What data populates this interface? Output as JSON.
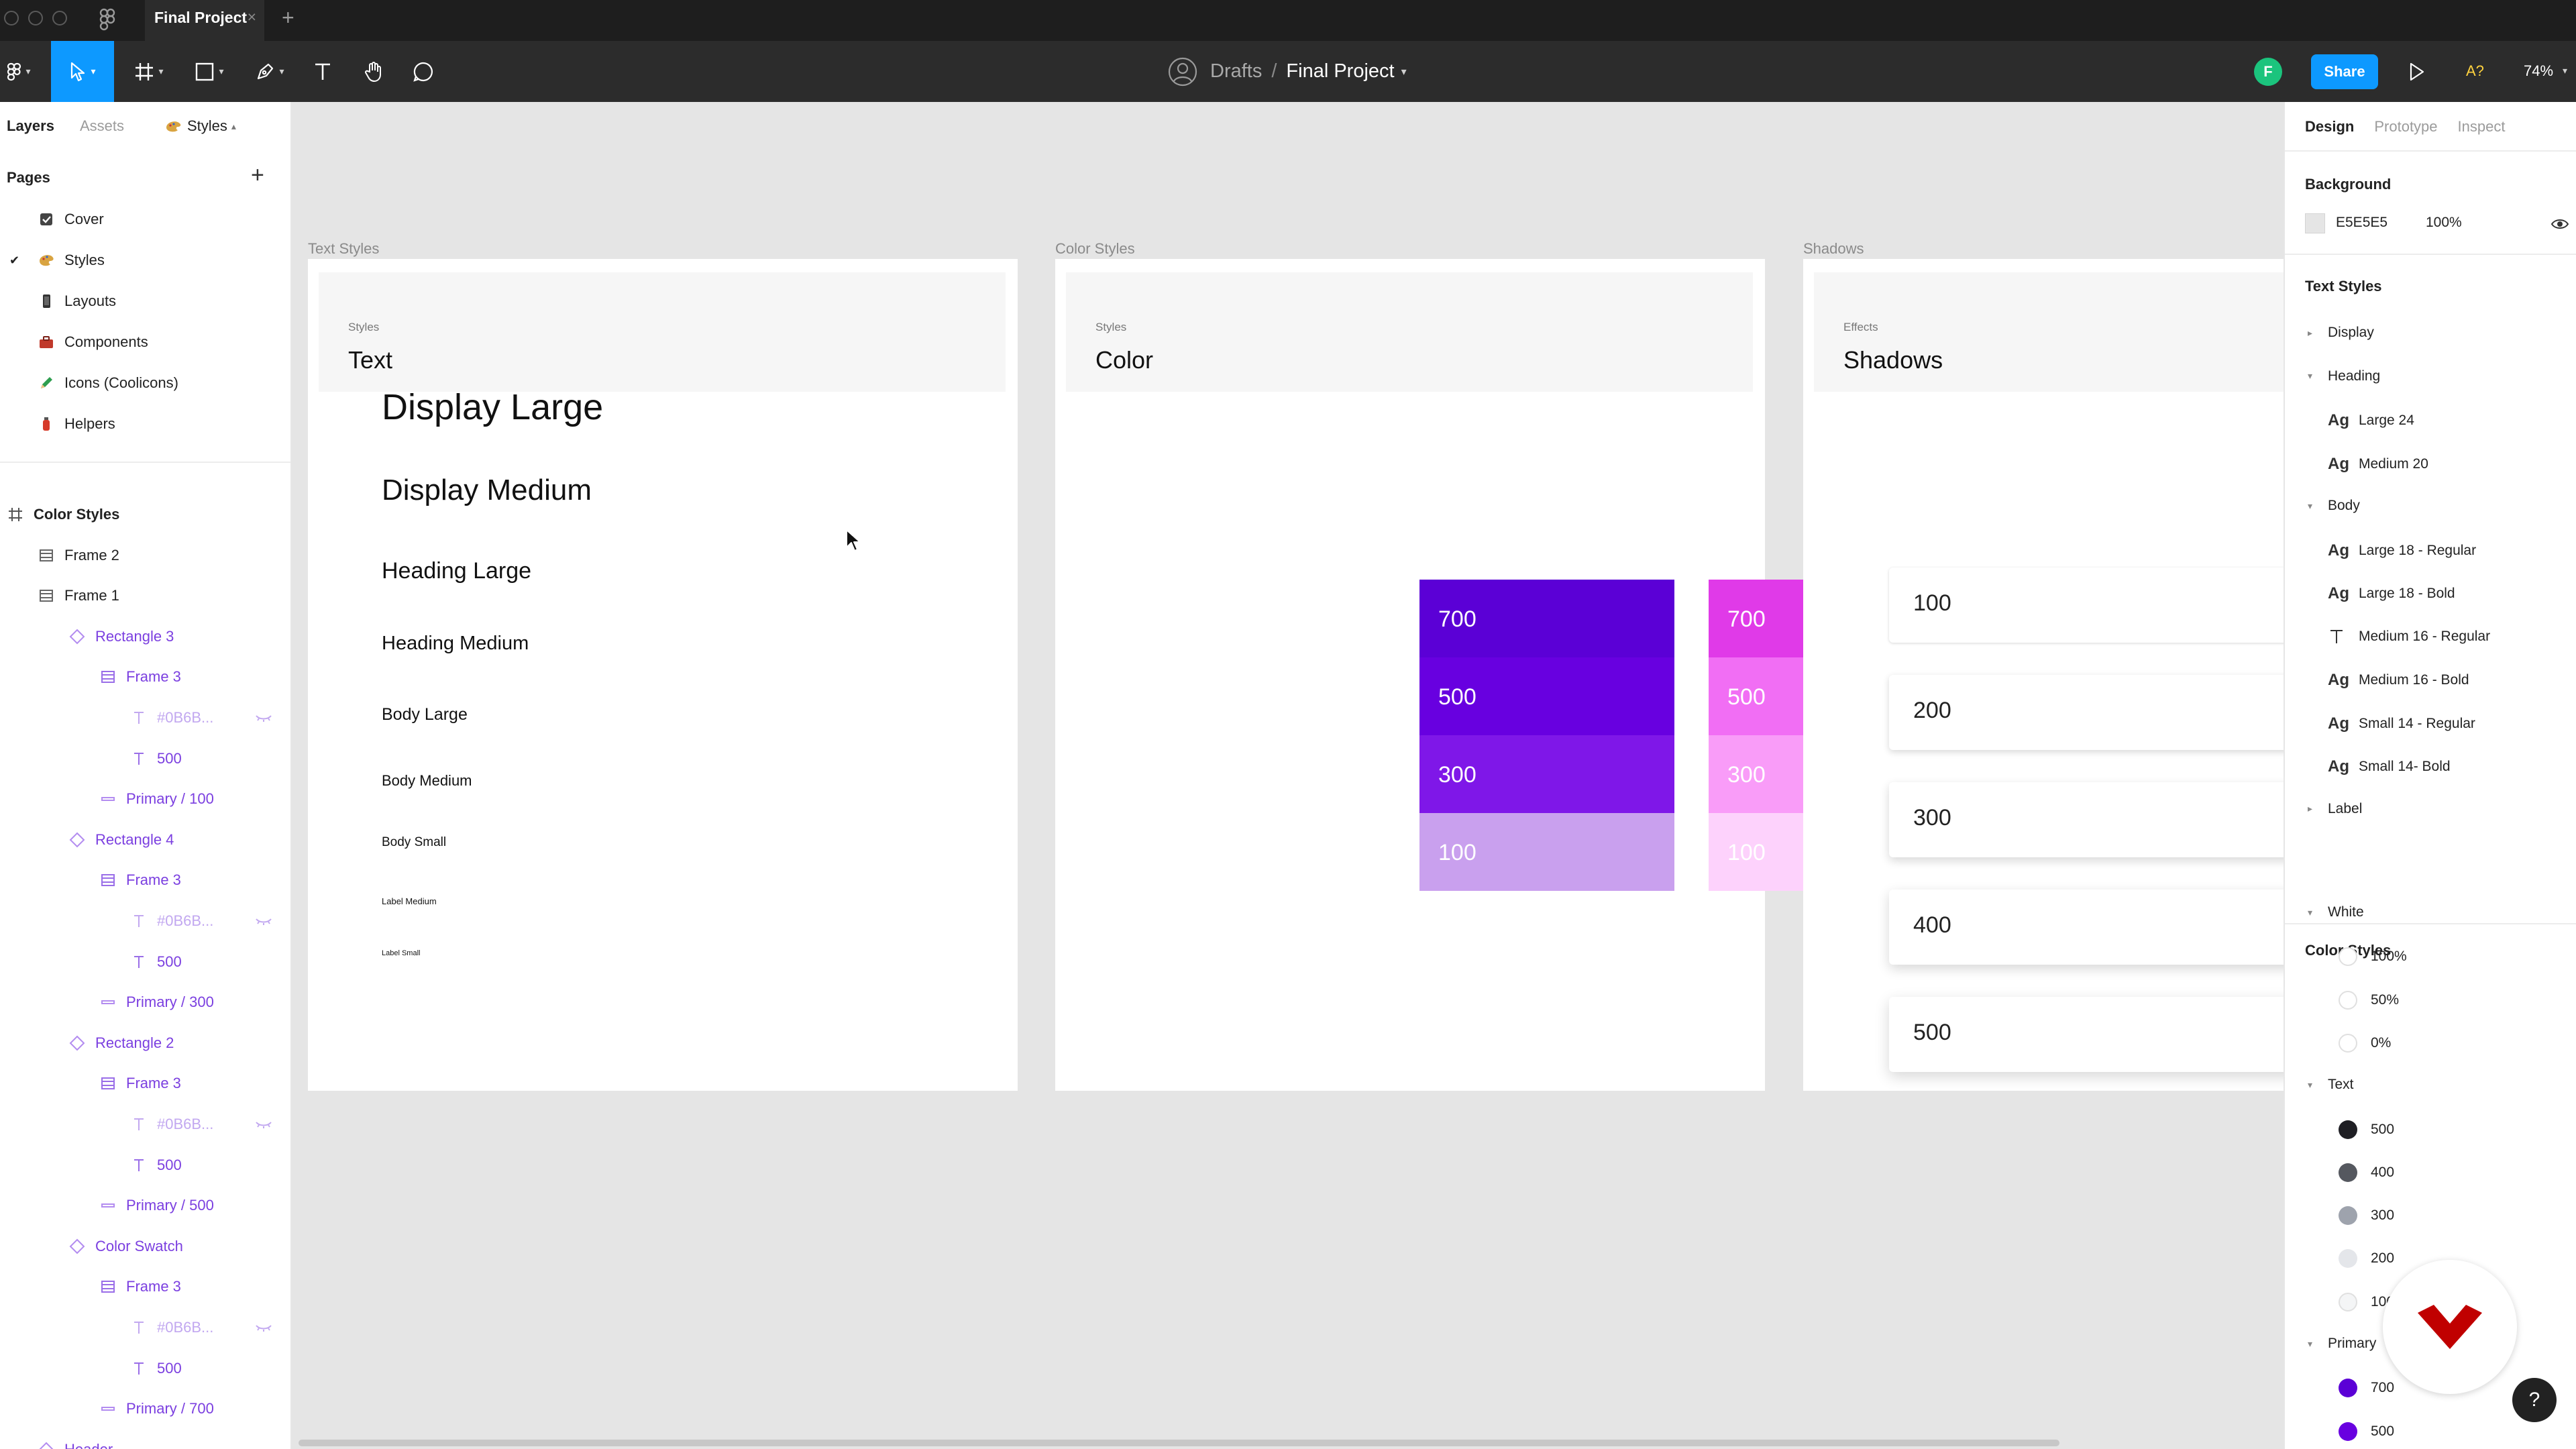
{
  "window": {
    "tab_title": "Final Project",
    "close_glyph": "×",
    "new_tab_glyph": "+"
  },
  "toolbar": {
    "breadcrumb_drafts": "Drafts",
    "breadcrumb_sep": "/",
    "breadcrumb_project": "Final Project",
    "avatar_letter": "F",
    "share_label": "Share",
    "a_label": "A?",
    "zoom": "74%",
    "accent": "#0d99ff",
    "avatar_color": "#1bc47d"
  },
  "left_panel": {
    "tabs": [
      "Layers",
      "Assets"
    ],
    "styles_tab": "Styles",
    "pages_title": "Pages",
    "add_glyph": "+",
    "pages": [
      {
        "name": "Cover",
        "emoji": "checkbox"
      },
      {
        "name": "Styles",
        "emoji": "paint",
        "selected": true
      },
      {
        "name": "Layouts",
        "emoji": "phone"
      },
      {
        "name": "Components",
        "emoji": "briefcase"
      },
      {
        "name": "Icons (Coolicons)",
        "emoji": "pencil"
      },
      {
        "name": "Helpers",
        "emoji": "fire-extinguisher"
      }
    ],
    "layers": [
      {
        "name": "Color Styles",
        "type": "grid",
        "indent": 0,
        "bold": true
      },
      {
        "name": "Frame 2",
        "type": "frame",
        "indent": 1
      },
      {
        "name": "Frame 1",
        "type": "frame",
        "indent": 1
      },
      {
        "name": "Rectangle 3",
        "type": "component",
        "indent": 2,
        "purple": true
      },
      {
        "name": "Frame 3",
        "type": "frame",
        "indent": 3,
        "purple": true
      },
      {
        "name": "#0B6B...",
        "type": "text",
        "indent": 4,
        "faded": true
      },
      {
        "name": "500",
        "type": "text",
        "indent": 4,
        "purple": true
      },
      {
        "name": "Primary / 100",
        "type": "line",
        "indent": 3,
        "purple": true
      },
      {
        "name": "Rectangle 4",
        "type": "component",
        "indent": 2,
        "purple": true
      },
      {
        "name": "Frame 3",
        "type": "frame",
        "indent": 3,
        "purple": true
      },
      {
        "name": "#0B6B...",
        "type": "text",
        "indent": 4,
        "faded": true
      },
      {
        "name": "500",
        "type": "text",
        "indent": 4,
        "purple": true
      },
      {
        "name": "Primary / 300",
        "type": "line",
        "indent": 3,
        "purple": true
      },
      {
        "name": "Rectangle 2",
        "type": "component",
        "indent": 2,
        "purple": true
      },
      {
        "name": "Frame 3",
        "type": "frame",
        "indent": 3,
        "purple": true
      },
      {
        "name": "#0B6B...",
        "type": "text",
        "indent": 4,
        "faded": true
      },
      {
        "name": "500",
        "type": "text",
        "indent": 4,
        "purple": true
      },
      {
        "name": "Primary / 500",
        "type": "line",
        "indent": 3,
        "purple": true
      },
      {
        "name": "Color Swatch",
        "type": "component",
        "indent": 2,
        "purple": true
      },
      {
        "name": "Frame 3",
        "type": "frame",
        "indent": 3,
        "purple": true
      },
      {
        "name": "#0B6B...",
        "type": "text",
        "indent": 4,
        "faded": true
      },
      {
        "name": "500",
        "type": "text",
        "indent": 4,
        "purple": true
      },
      {
        "name": "Primary / 700",
        "type": "line",
        "indent": 3,
        "purple": true
      },
      {
        "name": "Header",
        "type": "component",
        "indent": 1,
        "purple": true
      }
    ]
  },
  "canvas": {
    "text_frame": {
      "label": "Text Styles",
      "small": "Styles",
      "title": "Text",
      "styles": [
        {
          "text": "Display Large",
          "size": 54
        },
        {
          "text": "Display Medium",
          "size": 44
        },
        {
          "text": "Heading Large",
          "size": 34
        },
        {
          "text": "Heading Medium",
          "size": 29
        },
        {
          "text": "Body Large",
          "size": 25
        },
        {
          "text": "Body Medium",
          "size": 22
        },
        {
          "text": "Body Small",
          "size": 19
        },
        {
          "text": "Label Medium",
          "size": 13
        },
        {
          "text": "Label Small",
          "size": 11
        }
      ]
    },
    "color_frame": {
      "label": "Color Styles",
      "small": "Styles",
      "title": "Color",
      "columns": [
        [
          {
            "label": "700",
            "color": "#5b00d6"
          },
          {
            "label": "500",
            "color": "#6800e0"
          },
          {
            "label": "300",
            "color": "#7f17e8"
          },
          {
            "label": "100",
            "color": "#c9a0ee"
          }
        ],
        [
          {
            "label": "700",
            "color": "#e03ae8"
          },
          {
            "label": "500",
            "color": "#f16ef4"
          },
          {
            "label": "300",
            "color": "#f99cf8"
          },
          {
            "label": "100",
            "color": "#fdd2fc"
          }
        ]
      ]
    },
    "shadow_frame": {
      "label": "Shadows",
      "small": "Effects",
      "title": "Shadows",
      "cards": [
        {
          "label": "100",
          "blur": 4
        },
        {
          "label": "200",
          "blur": 10
        },
        {
          "label": "300",
          "blur": 14
        },
        {
          "label": "400",
          "blur": 18
        },
        {
          "label": "500",
          "blur": 22
        }
      ]
    }
  },
  "right_panel": {
    "tabs": [
      "Design",
      "Prototype",
      "Inspect"
    ],
    "background_title": "Background",
    "bg_hex": "E5E5E5",
    "bg_opacity": "100%",
    "text_styles_title": "Text Styles",
    "text_groups": [
      {
        "name": "Display",
        "open": false,
        "items": []
      },
      {
        "name": "Heading",
        "open": true,
        "items": [
          "Large 24",
          "Medium 20"
        ]
      },
      {
        "name": "Body",
        "open": true,
        "items": [
          "Large 18 - Regular",
          "Large 18 - Bold",
          "Medium 16 - Regular",
          "Medium 16 - Bold",
          "Small 14 - Regular",
          "Small 14- Bold"
        ]
      },
      {
        "name": "Label",
        "open": false,
        "items": []
      }
    ],
    "ag_glyph": "Ag",
    "color_styles_title": "Color Styles",
    "color_groups": [
      {
        "name": "White",
        "items": [
          {
            "label": "100%",
            "color": "#ffffff"
          },
          {
            "label": "50%",
            "color": "#ffffff80"
          },
          {
            "label": "0%",
            "color": "#ffffff00"
          }
        ]
      },
      {
        "name": "Text",
        "items": [
          {
            "label": "500",
            "color": "#1f1f24"
          },
          {
            "label": "400",
            "color": "#55585f"
          },
          {
            "label": "300",
            "color": "#9ea3ad"
          },
          {
            "label": "200",
            "color": "#e4e6ea"
          },
          {
            "label": "100",
            "color": "#f4f5f6"
          }
        ]
      },
      {
        "name": "Primary",
        "items": [
          {
            "label": "700",
            "color": "#5b00d6"
          },
          {
            "label": "500",
            "color": "#6800e0"
          }
        ]
      }
    ],
    "help_glyph": "?"
  }
}
